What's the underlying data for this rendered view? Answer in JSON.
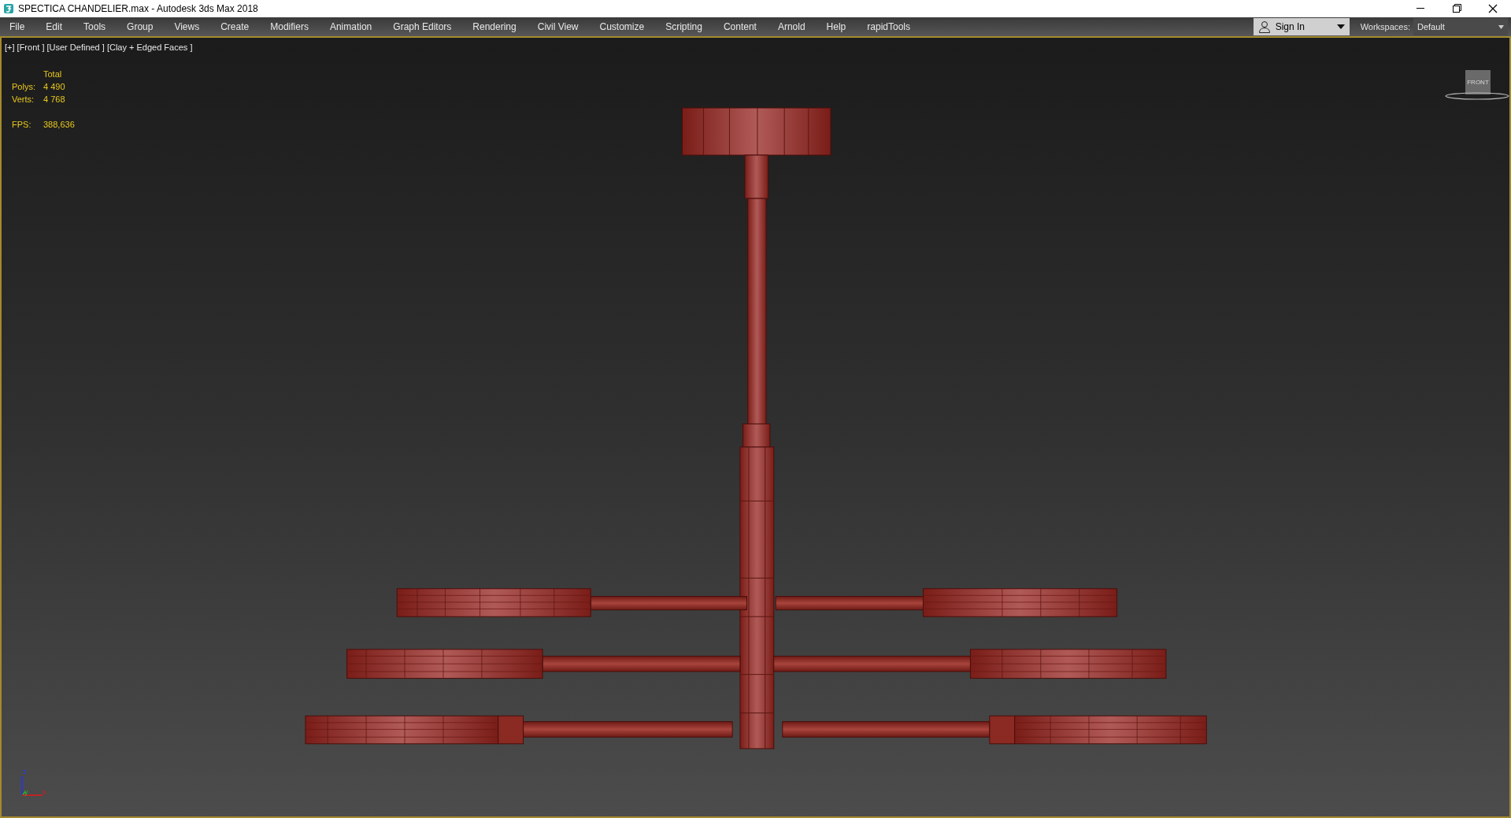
{
  "window": {
    "title": "SPECTICA CHANDELIER.max - Autodesk 3ds Max 2018"
  },
  "menu": [
    "File",
    "Edit",
    "Tools",
    "Group",
    "Views",
    "Create",
    "Modifiers",
    "Animation",
    "Graph Editors",
    "Rendering",
    "Civil View",
    "Customize",
    "Scripting",
    "Content",
    "Arnold",
    "Help",
    "rapidTools"
  ],
  "sign_in": "Sign In",
  "workspaces": {
    "label": "Workspaces:",
    "value": "Default"
  },
  "viewport": {
    "label": "[+] [Front ] [User Defined ] [Clay + Edged Faces ]",
    "stats": {
      "header": "Total",
      "rows": [
        {
          "label": "Polys:",
          "value": "4 490"
        },
        {
          "label": "Verts:",
          "value": "4 768"
        },
        {
          "label": "FPS:",
          "value": "388,636"
        }
      ]
    },
    "viewcube": "FRONT",
    "axes": [
      "x",
      "y",
      "z"
    ]
  }
}
